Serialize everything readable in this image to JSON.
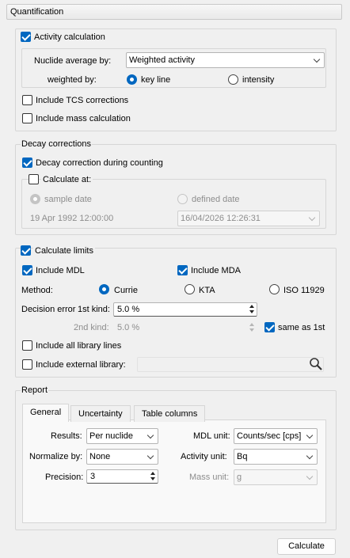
{
  "header": {
    "title": "Quantification"
  },
  "activity": {
    "checkbox_label": "Activity calculation",
    "checked": true,
    "nuclide_average_label": "Nuclide average by:",
    "nuclide_average_value": "Weighted activity",
    "weighted_by_label": "weighted by:",
    "weighted_by_options": [
      "key line",
      "intensity"
    ],
    "weighted_by_selected": "key line",
    "tcs_label": "Include TCS corrections",
    "tcs_checked": false,
    "mass_label": "Include mass calculation",
    "mass_checked": false
  },
  "decay": {
    "group_title": "Decay corrections",
    "during_counting_label": "Decay correction during counting",
    "during_counting_checked": true,
    "calculate_at_label": "Calculate at:",
    "calculate_at_checked": false,
    "sample_date_label": "sample date",
    "defined_date_label": "defined date",
    "sample_date_value": "19 Apr 1992 12:00:00",
    "defined_date_value": "16/04/2026 12:26:31"
  },
  "limits": {
    "checkbox_label": "Calculate limits",
    "checked": true,
    "mdl_label": "Include MDL",
    "mdl_checked": true,
    "mda_label": "Include MDA",
    "mda_checked": true,
    "method_label": "Method:",
    "methods": [
      "Currie",
      "KTA",
      "ISO 11929"
    ],
    "method_selected": "Currie",
    "decision_error_label": "Decision error",
    "first_kind_label": "1st kind:",
    "first_kind_value": "5.0 %",
    "second_kind_label": "2nd kind:",
    "second_kind_value": "5.0 %",
    "same_as_label": "same as 1st",
    "same_as_checked": true,
    "all_library_lines_label": "Include all library lines",
    "all_library_lines_checked": false,
    "external_library_label": "Include external library:",
    "external_library_checked": false,
    "external_library_value": ""
  },
  "report": {
    "group_title": "Report",
    "tabs": [
      "General",
      "Uncertainty",
      "Table columns"
    ],
    "active_tab": "General",
    "results_label": "Results:",
    "results_value": "Per nuclide",
    "normalize_label": "Normalize by:",
    "normalize_value": "None",
    "precision_label": "Precision:",
    "precision_value": "3",
    "mdl_unit_label": "MDL unit:",
    "mdl_unit_value": "Counts/sec [cps]",
    "activity_unit_label": "Activity unit:",
    "activity_unit_value": "Bq",
    "mass_unit_label": "Mass unit:",
    "mass_unit_value": "g"
  },
  "actions": {
    "calculate_label": "Calculate"
  },
  "colors": {
    "accent": "#0067c0",
    "disabled_text": "#8d8d8d",
    "background": "#f0f0f0"
  }
}
